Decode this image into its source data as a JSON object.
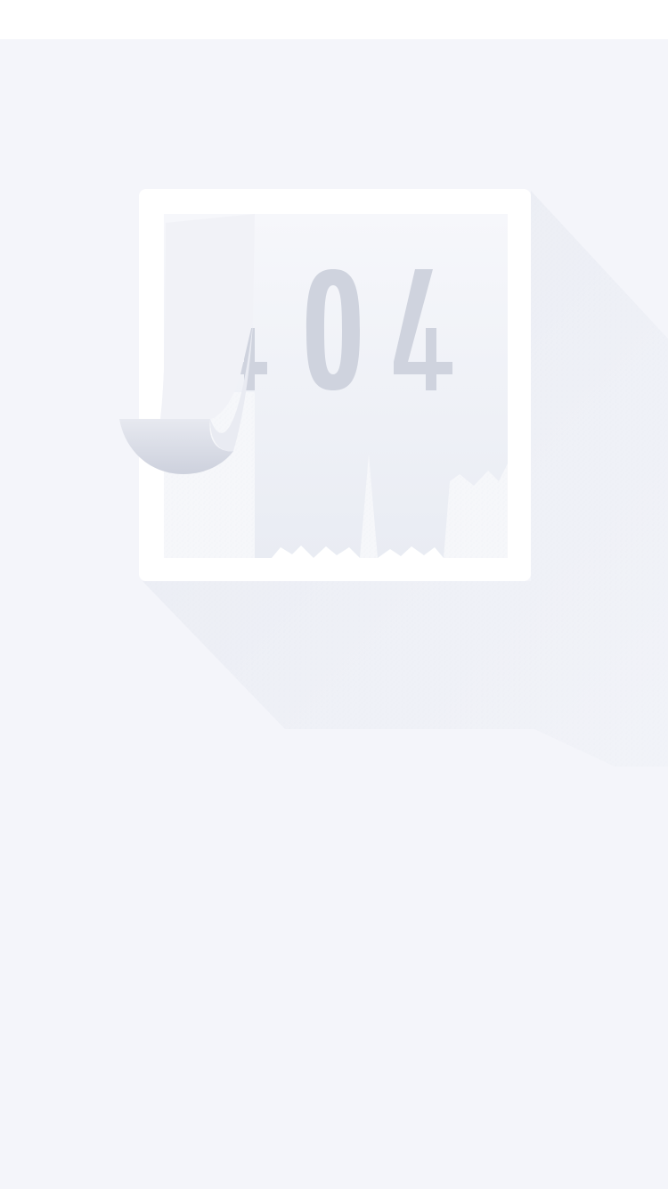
{
  "error": {
    "code": "404"
  },
  "colors": {
    "background": "#f4f5fa",
    "top_bar": "#ffffff",
    "frame": "#ffffff",
    "paper": "#eef0f6",
    "digits": "#cfd3de",
    "curl": "#d6d9e4",
    "shadow": "#e6e8f0"
  }
}
